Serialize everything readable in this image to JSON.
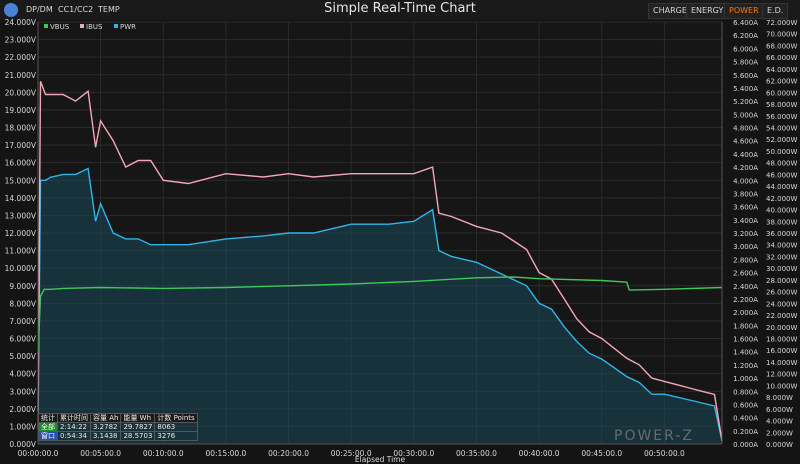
{
  "window": {
    "title": "Simple Real-Time Chart",
    "tabs": [
      "DP/DM",
      "CC1/CC2",
      "TEMP"
    ],
    "modes": [
      "CHARGE",
      "ENERGY",
      "POWER",
      "E.D."
    ],
    "selected_mode": "POWER",
    "brand_watermark": "POWER-Z"
  },
  "stats_table": {
    "headers": [
      "统计",
      "累计时间",
      "容量 Ah",
      "能量 Wh",
      "计数 Points"
    ],
    "rows": [
      {
        "label": "全部",
        "time": "2:14:22",
        "ah": "3.2782",
        "wh": "29.7827",
        "points": "8063"
      },
      {
        "label": "窗口",
        "time": "0:54:34",
        "ah": "3.1438",
        "wh": "28.5703",
        "points": "3276"
      }
    ]
  },
  "chart_data": {
    "type": "line",
    "xlabel": "Elapsed Time",
    "x_ticks": [
      "00:00:00.0",
      "00:05:00.0",
      "00:10:00.0",
      "00:15:00.0",
      "00:20:00.0",
      "00:25:00.0",
      "00:30:00.0",
      "00:35:00.0",
      "00:40:00.0",
      "00:45:00.0",
      "00:50:00.0"
    ],
    "x_range_minutes": [
      0,
      54.6
    ],
    "y_left": {
      "label": "VBUS",
      "unit": "V",
      "range": [
        0,
        24
      ],
      "step": 1
    },
    "y_right1": {
      "label": "IBUS",
      "unit": "A",
      "range": [
        0,
        6.4
      ],
      "step": 0.2
    },
    "y_right2": {
      "label": "PWR",
      "unit": "W",
      "range": [
        0,
        72
      ],
      "step": 2
    },
    "grid": true,
    "legend": "top-left",
    "colors": {
      "VBUS": "#3ec85a",
      "IBUS": "#f4a6b6",
      "PWR": "#33b3e6"
    },
    "series": [
      {
        "name": "VBUS",
        "x_min": [
          0,
          0.2,
          0.5,
          1,
          2,
          5,
          10,
          15,
          20,
          25,
          30,
          35,
          38,
          40,
          45,
          47,
          47.2,
          50,
          54.6
        ],
        "y_V": [
          5.1,
          8.4,
          8.8,
          8.8,
          8.85,
          8.9,
          8.85,
          8.9,
          9.0,
          9.1,
          9.25,
          9.45,
          9.5,
          9.4,
          9.3,
          9.2,
          8.75,
          8.8,
          8.9
        ]
      },
      {
        "name": "IBUS",
        "x_min": [
          0,
          0.2,
          0.6,
          1,
          2,
          3,
          4,
          4.6,
          5,
          6,
          7,
          8,
          9,
          10,
          12,
          15,
          18,
          20,
          22,
          25,
          28,
          30,
          31.5,
          32,
          33,
          35,
          37,
          39,
          40,
          41,
          42,
          43,
          44,
          45,
          46,
          47,
          48,
          49,
          50,
          51,
          52,
          53,
          54,
          54.6
        ],
        "y_A": [
          0.5,
          5.5,
          5.3,
          5.3,
          5.3,
          5.2,
          5.35,
          4.5,
          4.9,
          4.6,
          4.2,
          4.3,
          4.3,
          4.0,
          3.95,
          4.1,
          4.05,
          4.1,
          4.05,
          4.1,
          4.1,
          4.1,
          4.2,
          3.5,
          3.45,
          3.3,
          3.2,
          2.95,
          2.6,
          2.5,
          2.2,
          1.9,
          1.7,
          1.6,
          1.45,
          1.3,
          1.2,
          1.0,
          0.95,
          0.9,
          0.85,
          0.8,
          0.75,
          0.05
        ]
      },
      {
        "name": "PWR",
        "x_min": [
          0,
          0.2,
          0.6,
          1,
          2,
          3,
          4,
          4.6,
          5,
          6,
          7,
          8,
          9,
          10,
          12,
          15,
          18,
          20,
          22,
          25,
          28,
          30,
          31.5,
          32,
          33,
          35,
          37,
          39,
          40,
          41,
          42,
          43,
          44,
          45,
          46,
          47,
          48,
          49,
          50,
          51,
          52,
          53,
          54,
          54.6
        ],
        "y_W": [
          2.5,
          45,
          45,
          45.5,
          46,
          46,
          47,
          38,
          41,
          36,
          35,
          35,
          34,
          34,
          34,
          35,
          35.5,
          36,
          36,
          37.5,
          37.5,
          38,
          40,
          33,
          32,
          31,
          29,
          27,
          24,
          23,
          20,
          17.5,
          15.5,
          14.5,
          13,
          11.5,
          10.5,
          8.5,
          8.5,
          8,
          7.5,
          7,
          6.5,
          0.5
        ]
      }
    ]
  }
}
